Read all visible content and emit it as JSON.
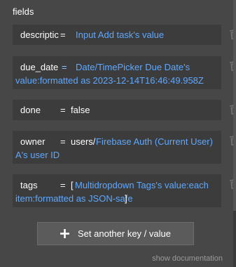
{
  "heading": "fields",
  "rows": [
    {
      "key": "descriptic",
      "eq": "=",
      "value_line1": "Input Add task's value"
    },
    {
      "key": "due_date",
      "eq": "=",
      "value_line1": "Date/TimePicker Due Date's",
      "value_line2": "value:formatted as 2023-12-14T16:46:49.958Z"
    },
    {
      "key": "done",
      "eq": "=",
      "value_line1": "false"
    },
    {
      "key": "owner",
      "eq": "=",
      "value_prefix": "users/",
      "value_line1": "Firebase Auth (Current User)",
      "value_line2": "A's user ID"
    },
    {
      "key": "tags",
      "eq": "=",
      "bracket_open": "[",
      "value_line1": "Multidropdown Tags's value:each",
      "value_line2": "item:formatted as JSON-safe",
      "bracket_close": "]"
    }
  ],
  "add_button": {
    "label": "Set another key / value",
    "icon": "plus-icon"
  },
  "show_documentation": "show documentation",
  "colors": {
    "background": "#474747",
    "row_background": "#3c3c3c",
    "dynamic_value": "#5ea8ff",
    "button": "#5b5b5b",
    "muted": "#9a9a9a"
  }
}
